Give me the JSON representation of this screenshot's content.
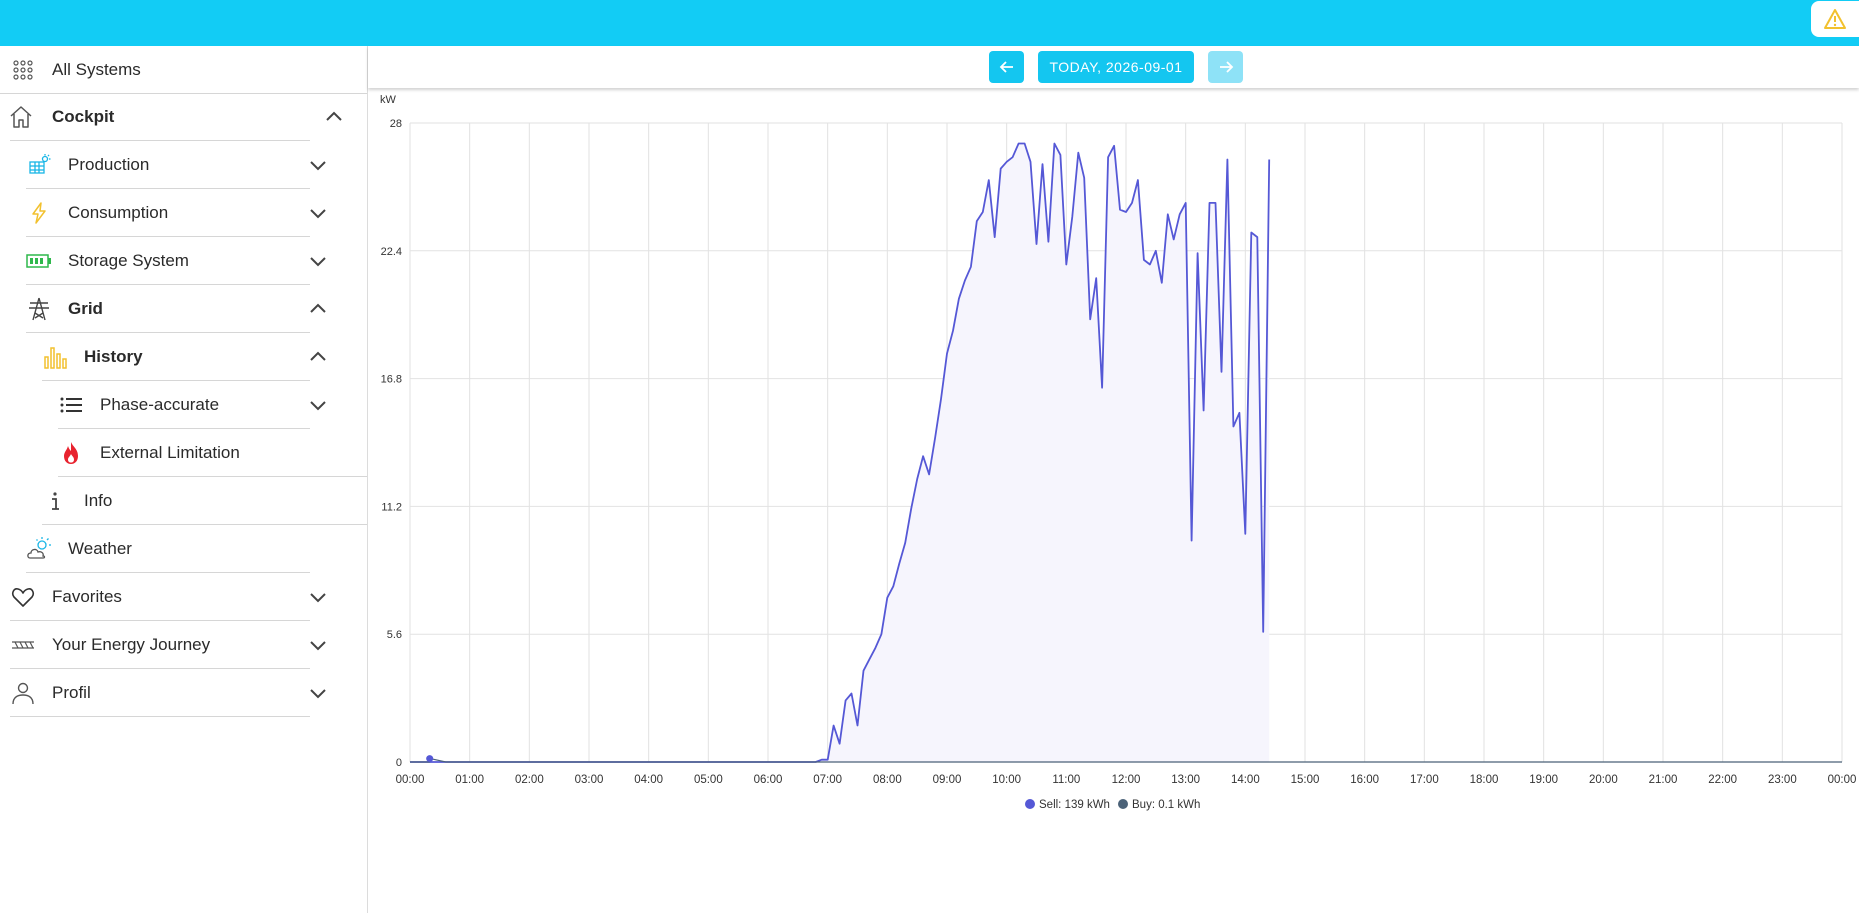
{
  "header": {
    "warning_icon": "warning-icon"
  },
  "sidebar": {
    "all_systems": "All Systems",
    "cockpit": "Cockpit",
    "production": "Production",
    "consumption": "Consumption",
    "storage": "Storage System",
    "grid": "Grid",
    "history": "History",
    "phase": "Phase-accurate",
    "external": "External Limitation",
    "info": "Info",
    "weather": "Weather",
    "favorites": "Favorites",
    "journey": "Your Energy Journey",
    "profil": "Profil"
  },
  "datebar": {
    "date_label": "TODAY, 2026-09-01",
    "prev": "arrow-left-icon",
    "next": "arrow-right-icon"
  },
  "colors": {
    "topbar": "#12ccf5",
    "sell": "#5558d6",
    "buy": "#4b6278",
    "fill": "#f6f5fd"
  },
  "chart_data": {
    "type": "line",
    "ylabel": "kW",
    "ylim": [
      0,
      28
    ],
    "yticks": [
      "0",
      "5.6",
      "11.2",
      "16.8",
      "22.4",
      "28"
    ],
    "xticks": [
      "00:00",
      "01:00",
      "02:00",
      "03:00",
      "04:00",
      "05:00",
      "06:00",
      "07:00",
      "08:00",
      "09:00",
      "10:00",
      "11:00",
      "12:00",
      "13:00",
      "14:00",
      "15:00",
      "16:00",
      "17:00",
      "18:00",
      "19:00",
      "20:00",
      "21:00",
      "22:00",
      "23:00",
      "00:00"
    ],
    "legend": [
      "Sell: 139 kWh",
      "Buy: 0.1 kWh"
    ],
    "series": [
      {
        "name": "Sell: 139 kWh",
        "x": [
          0,
          0.5,
          1,
          2,
          3,
          4,
          5,
          6,
          6.5,
          6.7,
          6.8,
          6.9,
          7.0,
          7.1,
          7.2,
          7.3,
          7.4,
          7.5,
          7.6,
          7.7,
          7.8,
          7.9,
          8.0,
          8.1,
          8.2,
          8.3,
          8.4,
          8.5,
          8.6,
          8.7,
          8.8,
          8.9,
          9.0,
          9.1,
          9.2,
          9.3,
          9.4,
          9.5,
          9.6,
          9.7,
          9.8,
          9.9,
          10.0,
          10.1,
          10.2,
          10.3,
          10.4,
          10.5,
          10.6,
          10.7,
          10.8,
          10.9,
          11.0,
          11.1,
          11.2,
          11.3,
          11.4,
          11.5,
          11.6,
          11.7,
          11.8,
          11.9,
          12.0,
          12.1,
          12.2,
          12.3,
          12.4,
          12.5,
          12.6,
          12.7,
          12.8,
          12.9,
          13.0,
          13.1,
          13.2,
          13.3,
          13.4,
          13.5,
          13.6,
          13.7,
          13.8,
          13.9,
          14.0,
          14.1,
          14.2,
          14.3,
          14.4
        ],
        "y": [
          0,
          0,
          0,
          0,
          0,
          0,
          0,
          0,
          0,
          0,
          0,
          0.1,
          0.1,
          1.6,
          0.8,
          2.7,
          3.0,
          1.6,
          4.0,
          4.5,
          5.0,
          5.6,
          7.2,
          7.7,
          8.7,
          9.6,
          11.1,
          12.4,
          13.4,
          12.6,
          14.2,
          15.9,
          17.9,
          18.9,
          20.3,
          21.1,
          21.7,
          23.7,
          24.1,
          25.5,
          23.0,
          26.0,
          26.3,
          26.5,
          27.1,
          27.1,
          26.3,
          22.7,
          26.2,
          22.8,
          27.1,
          26.6,
          21.8,
          23.9,
          26.7,
          25.6,
          19.4,
          21.2,
          16.4,
          26.5,
          27.0,
          24.2,
          24.1,
          24.5,
          25.5,
          22.0,
          21.8,
          22.4,
          21.0,
          24.0,
          22.9,
          24.0,
          24.5,
          9.7,
          22.3,
          15.4,
          24.5,
          24.5,
          17.1,
          26.4,
          14.7,
          15.3,
          10.0,
          23.2,
          23.0,
          5.7,
          26.4
        ]
      },
      {
        "name": "Buy: 0.1 kWh",
        "x": [
          0,
          0.33,
          0.34,
          0.6,
          24
        ],
        "y": [
          0,
          0,
          0.15,
          0,
          0
        ]
      }
    ]
  }
}
